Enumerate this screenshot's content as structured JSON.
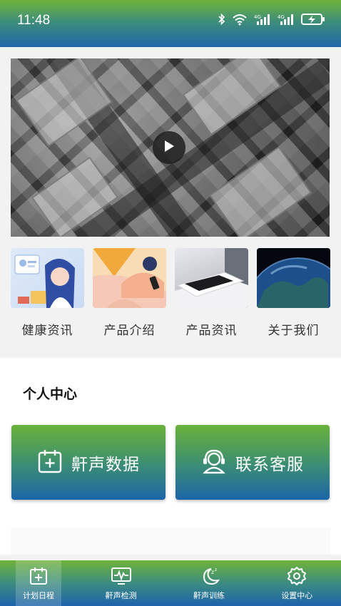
{
  "status_bar": {
    "time": "11:48",
    "icons": [
      "bluetooth-icon",
      "wifi-icon",
      "4g-signal-icon",
      "4g-signal-icon",
      "battery-charging-icon"
    ]
  },
  "video": {
    "play_icon": "play-icon"
  },
  "categories": [
    {
      "label": "健康资讯",
      "thumb": "doctor-illustration"
    },
    {
      "label": "产品介绍",
      "thumb": "person-with-phone-illustration"
    },
    {
      "label": "产品资讯",
      "thumb": "phone-on-pad-photo"
    },
    {
      "label": "关于我们",
      "thumb": "earth-photo"
    }
  ],
  "personal": {
    "title": "个人中心",
    "buttons": [
      {
        "label": "鼾声数据",
        "icon": "calendar-plus-icon"
      },
      {
        "label": "联系客服",
        "icon": "headset-icon"
      }
    ]
  },
  "tabs": [
    {
      "label": "计划日程",
      "icon": "calendar-plus-icon",
      "active": true
    },
    {
      "label": "鼾声检测",
      "icon": "monitor-wave-icon",
      "active": false
    },
    {
      "label": "鼾声训练",
      "icon": "moon-sleep-icon",
      "active": false
    },
    {
      "label": "设置中心",
      "icon": "gear-icon",
      "active": false
    }
  ],
  "colors": {
    "green": "#6fb33a",
    "blue": "#1d63ab",
    "background": "#f2f2f2"
  }
}
